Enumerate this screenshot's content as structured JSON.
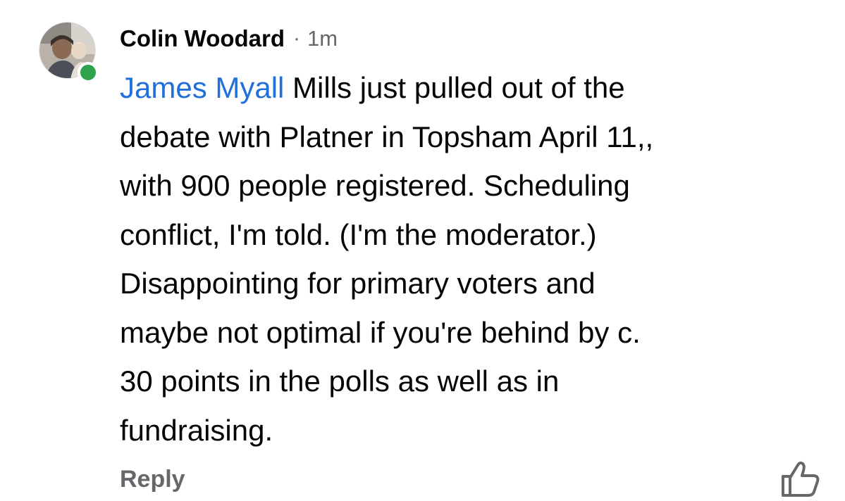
{
  "comment": {
    "author": "Colin Woodard",
    "separator": "·",
    "time": "1m",
    "mention": "James Myall",
    "lines": [
      " Mills just pulled out of the",
      "debate with Platner in Topsham April 11,,",
      "with 900 people registered. Scheduling",
      "conflict, I'm told. (I'm the moderator.)",
      "Disappointing for primary voters and",
      "maybe not optimal if you're behind by c.",
      "30 points in the polls as well as in",
      "fundraising."
    ],
    "reply_label": "Reply",
    "avatar_icon": "profile-photo",
    "online_indicator": "online-status-dot",
    "like_icon": "thumbs-up-icon"
  },
  "colors": {
    "mention": "#216fdb",
    "meta": "#65676b",
    "online": "#31a24c",
    "text": "#050505"
  }
}
